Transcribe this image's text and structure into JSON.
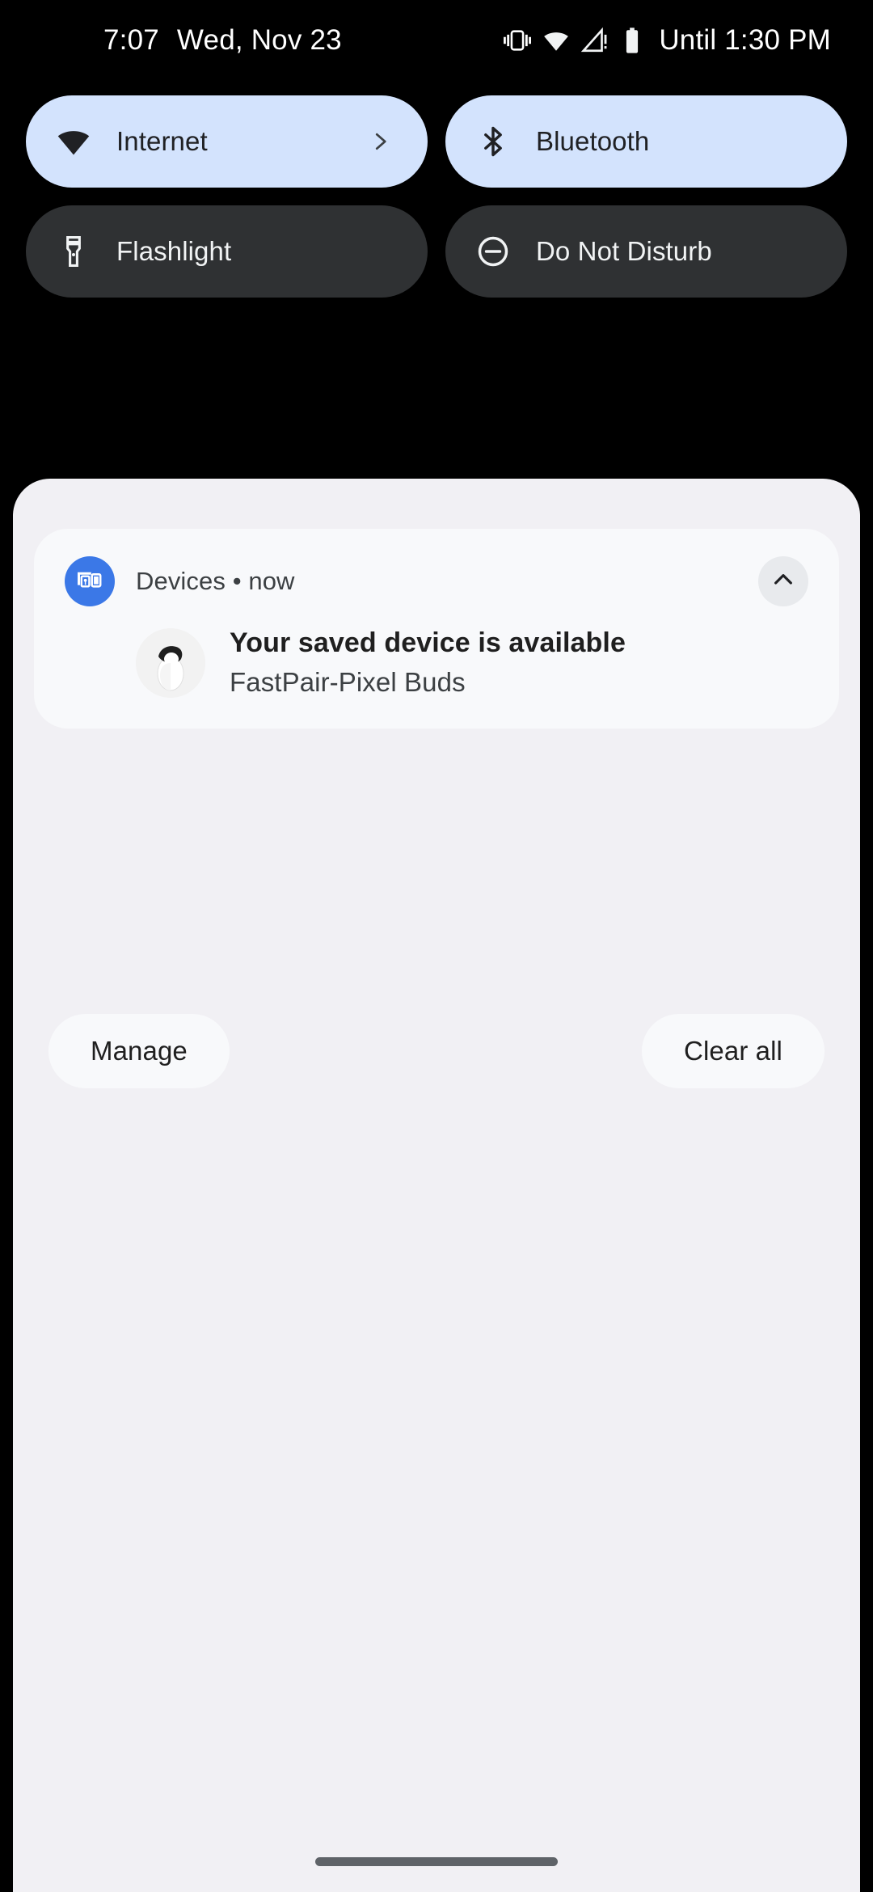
{
  "status_bar": {
    "time": "7:07",
    "date": "Wed, Nov 23",
    "icons": [
      "vibrate-icon",
      "wifi-icon",
      "cellular-signal-warning-icon",
      "battery-icon"
    ],
    "battery_estimate": "Until 1:30 PM"
  },
  "quick_settings": {
    "tiles": [
      {
        "label": "Internet",
        "icon": "wifi-icon",
        "state": "on",
        "has_chevron": true
      },
      {
        "label": "Bluetooth",
        "icon": "bluetooth-icon",
        "state": "on",
        "has_chevron": false
      },
      {
        "label": "Flashlight",
        "icon": "flashlight-icon",
        "state": "off",
        "has_chevron": false
      },
      {
        "label": "Do Not Disturb",
        "icon": "do-not-disturb-icon",
        "state": "off",
        "has_chevron": false
      }
    ]
  },
  "notification": {
    "app_name": "Devices",
    "separator": "•",
    "time": "now",
    "title": "Your saved device is available",
    "subtitle": "FastPair-Pixel Buds",
    "app_icon": "devices-cast-icon",
    "device_image": "pixel-buds-case-image",
    "expand_icon": "chevron-up-icon"
  },
  "footer": {
    "manage_label": "Manage",
    "clear_all_label": "Clear all"
  },
  "colors": {
    "background": "#000000",
    "shade": "#f1f0f4",
    "tile_on_bg": "#d3e3fd",
    "tile_off_bg": "#2f3133",
    "card_bg": "#f8f9fb",
    "app_icon_blue": "#3b78e7",
    "text_primary": "#1f1f1f",
    "text_on_dark": "#f1f3f4"
  }
}
